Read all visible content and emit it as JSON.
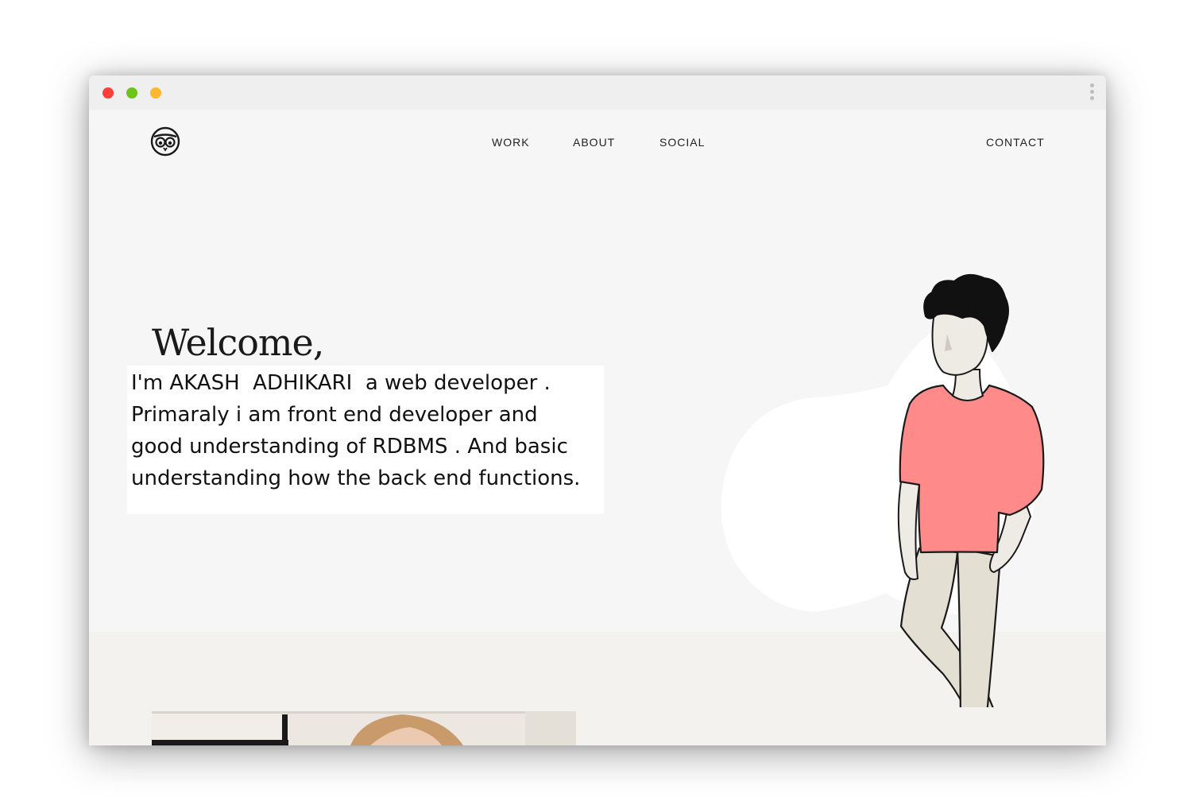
{
  "window": {
    "controls": [
      "close",
      "minimize",
      "maximize"
    ],
    "menu_icon": "kebab-icon"
  },
  "header": {
    "logo_icon": "owl-logo-icon",
    "nav": {
      "work": "WORK",
      "about": "ABOUT",
      "social": "SOCIAL",
      "contact": "CONTACT"
    }
  },
  "hero": {
    "title": "Welcome,",
    "intro": "I'm AKASH  ADHIKARI  a web developer .\nPrimaraly i am front end developer and\ngood understanding of RDBMS . And basic\nunderstanding how the back end functions.",
    "illustration": "standing-man-illustration"
  },
  "colors": {
    "shirt": "#ff8a8a",
    "pants": "#e3dfd3",
    "hair": "#111111",
    "page_bg": "#f6f6f6",
    "band_bg": "#f4f2ef"
  }
}
